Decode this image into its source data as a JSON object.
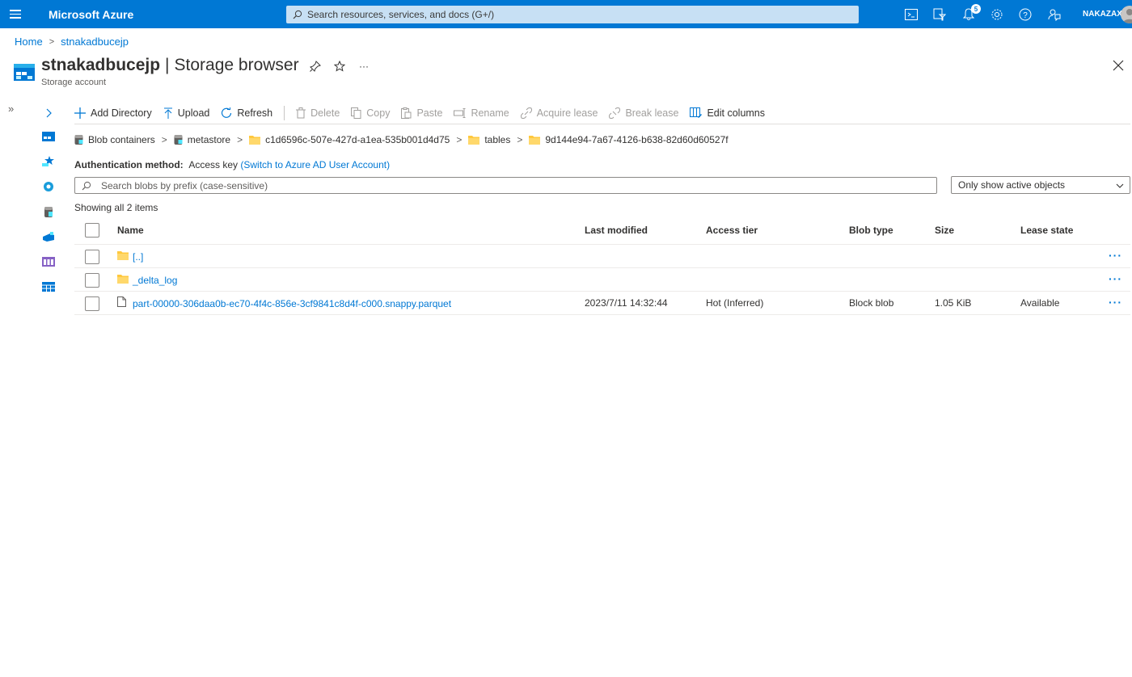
{
  "topbar": {
    "brand": "Microsoft Azure",
    "search_placeholder": "Search resources, services, and docs (G+/)",
    "notification_count": "5",
    "username": "NAKAZAX"
  },
  "breadcrumb": {
    "home": "Home",
    "current": "stnakadbucejp"
  },
  "header": {
    "resource_name": "stnakadbucejp",
    "separator": "|",
    "page_name": "Storage browser",
    "subtitle": "Storage account",
    "more": "···"
  },
  "toolbar": {
    "add_directory": "Add Directory",
    "upload": "Upload",
    "refresh": "Refresh",
    "delete": "Delete",
    "copy": "Copy",
    "paste": "Paste",
    "rename": "Rename",
    "acquire_lease": "Acquire lease",
    "break_lease": "Break lease",
    "edit_columns": "Edit columns"
  },
  "path": [
    {
      "label": "Blob containers",
      "icon": "container-icon"
    },
    {
      "label": "metastore",
      "icon": "container-icon"
    },
    {
      "label": "c1d6596c-507e-427d-a1ea-535b001d4d75",
      "icon": "folder-icon"
    },
    {
      "label": "tables",
      "icon": "folder-icon"
    },
    {
      "label": "9d144e94-7a67-4126-b638-82d60d60527f",
      "icon": "folder-icon"
    }
  ],
  "auth": {
    "label": "Authentication method:",
    "value": "Access key",
    "switch_link": "(Switch to Azure AD User Account)"
  },
  "blob_search": {
    "placeholder": "Search blobs by prefix (case-sensitive)"
  },
  "filter": {
    "selected": "Only show active objects"
  },
  "showing": "Showing all 2 items",
  "table": {
    "columns": {
      "name": "Name",
      "last_modified": "Last modified",
      "access_tier": "Access tier",
      "blob_type": "Blob type",
      "size": "Size",
      "lease_state": "Lease state"
    },
    "rows": [
      {
        "name": "[..]",
        "type": "folder",
        "last_modified": "",
        "access_tier": "",
        "blob_type": "",
        "size": "",
        "lease_state": "",
        "more": "···"
      },
      {
        "name": "_delta_log",
        "type": "folder",
        "last_modified": "",
        "access_tier": "",
        "blob_type": "",
        "size": "",
        "lease_state": "",
        "more": "···"
      },
      {
        "name": "part-00000-306daa0b-ec70-4f4c-856e-3cf9841c8d4f-c000.snappy.parquet",
        "type": "file",
        "last_modified": "2023/7/11 14:32:44",
        "access_tier": "Hot (Inferred)",
        "blob_type": "Block blob",
        "size": "1.05 KiB",
        "lease_state": "Available",
        "more": "···"
      }
    ]
  },
  "colors": {
    "brand_blue": "#0078d4",
    "folder_yellow": "#ffc83d"
  }
}
